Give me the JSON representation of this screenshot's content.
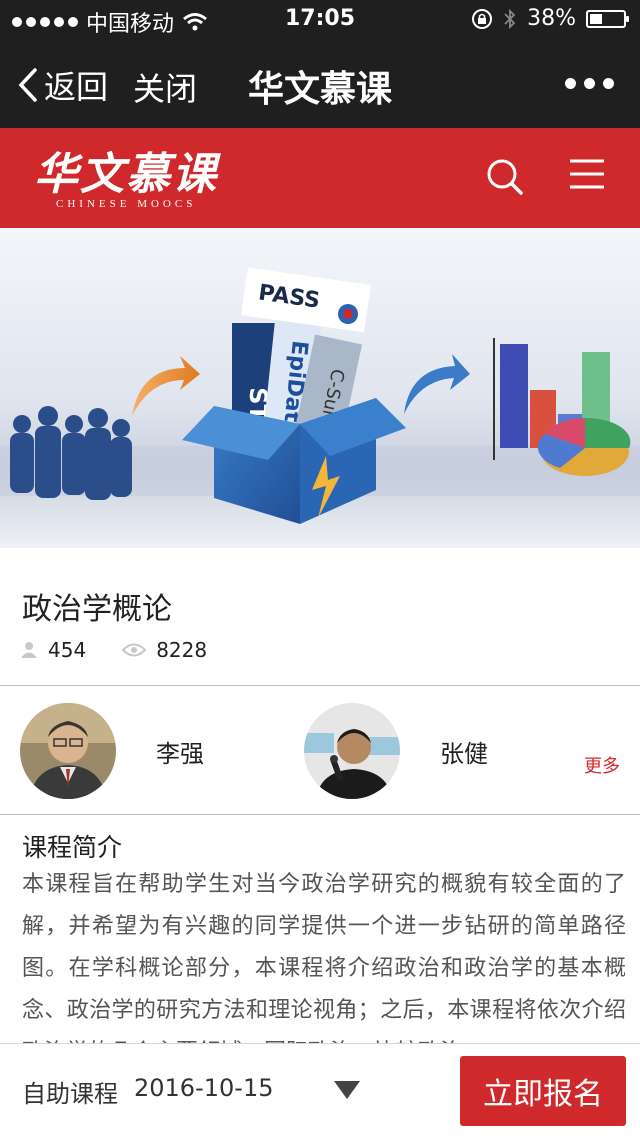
{
  "status_bar": {
    "carrier": "中国移动",
    "time": "17:05",
    "battery": "38%",
    "battery_level": 0.38,
    "icons": [
      "signal-dots-icon",
      "wifi-icon",
      "rotation-lock-icon",
      "bluetooth-icon",
      "battery-icon"
    ]
  },
  "nav": {
    "back_label": "返回",
    "close_label": "关闭",
    "title": "华文慕课",
    "more_icon": "more-dots-icon"
  },
  "header": {
    "logo_cn": "华文慕课",
    "logo_en": "CHINESE MOOCS",
    "icons": [
      "search-icon",
      "menu-icon"
    ]
  },
  "banner": {
    "box_labels": [
      "PASS",
      "STATA",
      "EpiData",
      "C-Survey"
    ]
  },
  "course": {
    "title": "政治学概论",
    "learners": "454",
    "views": "8228"
  },
  "teachers": [
    {
      "name": "李强"
    },
    {
      "name": "张健"
    }
  ],
  "more_label": "更多",
  "intro": {
    "title": "课程简介",
    "text": "本课程旨在帮助学生对当今政治学研究的概貌有较全面的了解，并希望为有兴趣的同学提供一个进一步钻研的简单路径图。在学科概论部分，本课程将介绍政治和政治学的基本概念、政治学的研究方法和理论视角；之后，本课程将依次介绍政治学的几个主要领域：国际政治、比较政治"
  },
  "bottom_bar": {
    "course_type": "自助课程",
    "date": "2016-10-15",
    "enroll_label": "立即报名"
  },
  "colors": {
    "brand_red": "#d0292b",
    "topbar": "#1f1f1f"
  }
}
